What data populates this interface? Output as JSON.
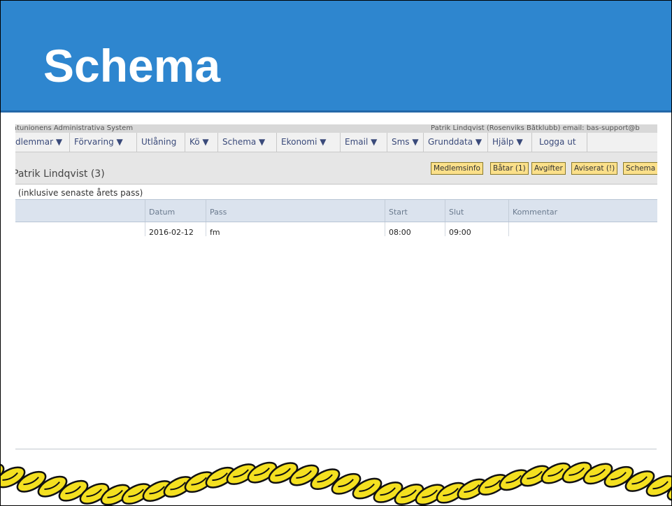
{
  "slide": {
    "title": "Schema"
  },
  "app": {
    "system_name": "åtunionens Administrativa System",
    "user_info": "Patrik Lindqvist (Rosenviks Båtklubb) email: bas-support@b",
    "menu": [
      {
        "label": "dlemmar ▼"
      },
      {
        "label": "Förvaring ▼"
      },
      {
        "label": "Utlåning"
      },
      {
        "label": "Kö ▼"
      },
      {
        "label": "Schema ▼"
      },
      {
        "label": "Ekonomi ▼"
      },
      {
        "label": "Email ▼"
      },
      {
        "label": "Sms ▼"
      },
      {
        "label": "Grunddata ▼"
      },
      {
        "label": "Hjälp ▼"
      },
      {
        "label": "Logga ut"
      }
    ],
    "member_heading": "Patrik Lindqvist (3)",
    "member_buttons": [
      {
        "label": "Medlemsinfo"
      },
      {
        "label": "Båtar (1)"
      },
      {
        "label": "Avgifter"
      },
      {
        "label": "Aviserat (!)"
      },
      {
        "label": "Schema"
      }
    ],
    "section_title": ": (inklusive senaste årets pass)",
    "table": {
      "columns": [
        "Datum",
        "Pass",
        "Start",
        "Slut",
        "Kommentar"
      ],
      "rows": [
        {
          "Datum": "2016-02-12",
          "Pass": "fm",
          "Start": "08:00",
          "Slut": "09:00",
          "Kommentar": ""
        }
      ]
    }
  }
}
